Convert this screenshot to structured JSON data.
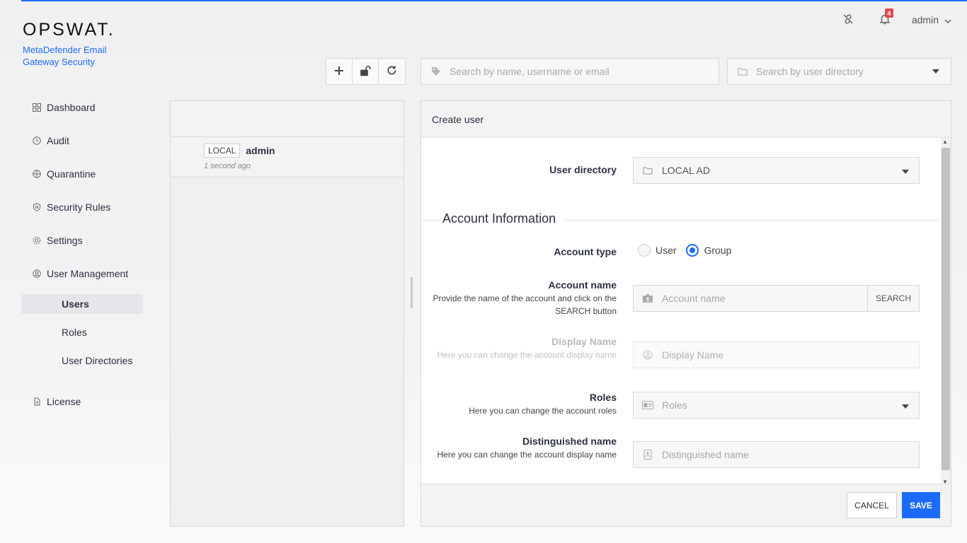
{
  "brand": {
    "logo": "OPSWAT.",
    "product": "MetaDefender Email Gateway Security"
  },
  "colors": {
    "accent": "#1d6bfc",
    "badge": "#e24a4a"
  },
  "header": {
    "notification_count": "4",
    "username": "admin"
  },
  "sidebar": {
    "items": [
      {
        "label": "Dashboard",
        "icon": "dashboard-icon"
      },
      {
        "label": "Audit",
        "icon": "audit-icon"
      },
      {
        "label": "Quarantine",
        "icon": "quarantine-icon"
      },
      {
        "label": "Security Rules",
        "icon": "shield-icon"
      },
      {
        "label": "Settings",
        "icon": "gear-icon"
      },
      {
        "label": "User Management",
        "icon": "user-management-icon"
      }
    ],
    "sub_items": [
      {
        "label": "Users",
        "active": true
      },
      {
        "label": "Roles"
      },
      {
        "label": "User Directories"
      }
    ],
    "license": "License"
  },
  "toolbar": {
    "search_placeholder": "Search by name, username or email",
    "directory_placeholder": "Search by user directory"
  },
  "user_list": [
    {
      "tag": "LOCAL",
      "name": "admin",
      "time": "1 second ago"
    }
  ],
  "form": {
    "title": "Create user",
    "user_directory": {
      "label": "User directory",
      "value": "LOCAL AD"
    },
    "section_title": "Account Information",
    "account_type": {
      "label": "Account type",
      "options": [
        "User",
        "Group"
      ],
      "selected": "Group"
    },
    "account_name": {
      "label": "Account name",
      "desc": "Provide the name of the account and click on the SEARCH button",
      "placeholder": "Account name",
      "button": "SEARCH"
    },
    "display_name": {
      "label": "Display Name",
      "desc": "Here you can change the account display name",
      "placeholder": "Display Name"
    },
    "roles": {
      "label": "Roles",
      "desc": "Here you can change the account roles",
      "placeholder": "Roles"
    },
    "distinguished_name": {
      "label": "Distinguished name",
      "desc": "Here you can change the account display name",
      "placeholder": "Distinguished name"
    },
    "cancel": "CANCEL",
    "save": "SAVE"
  }
}
